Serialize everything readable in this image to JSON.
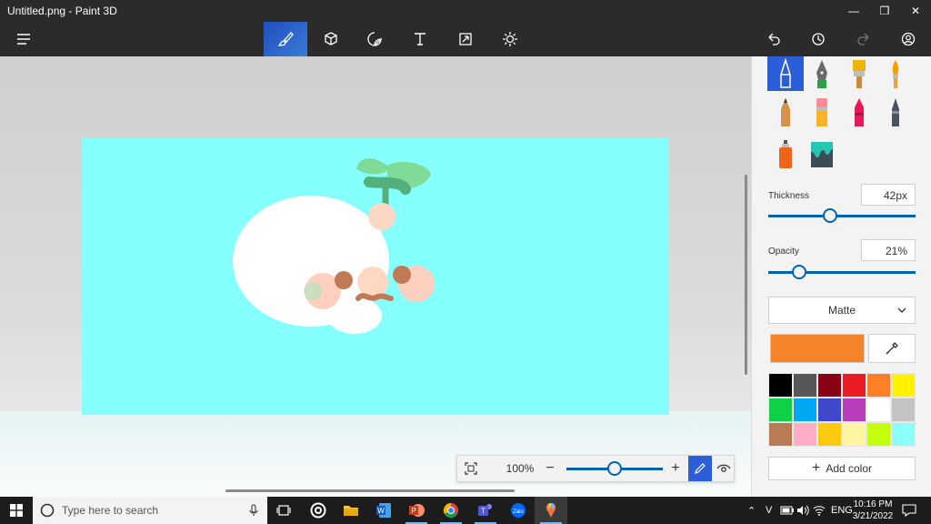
{
  "window": {
    "title": "Untitled.png - Paint 3D"
  },
  "toolbar": {
    "tools": [
      "brushes",
      "3d-shapes",
      "stickers",
      "text",
      "effects",
      "canvas",
      "magic-select"
    ],
    "icons": {
      "menu": "hamburger-icon",
      "undo": "undo-icon",
      "history": "history-icon",
      "redo": "redo-icon",
      "profile": "profile-icon"
    }
  },
  "zoom": {
    "value": "100%",
    "level": 0.5
  },
  "panel": {
    "thickness_label": "Thickness",
    "thickness_value": "42px",
    "thickness_level": 0.42,
    "opacity_label": "Opacity",
    "opacity_value": "21%",
    "opacity_level": 0.21,
    "finish": "Matte",
    "current_color": "#f5832a",
    "add_color_label": "Add color",
    "palette": [
      "#000000",
      "#575757",
      "#870014",
      "#ec1c24",
      "#ff7f27",
      "#fff200",
      "#0ed145",
      "#00a8f3",
      "#3f48cc",
      "#b83dba",
      "#ffffff",
      "#c3c3c3",
      "#b97a56",
      "#ffaec8",
      "#ffc90e",
      "#fff5a0",
      "#c4ff0e",
      "#8cfffb"
    ]
  },
  "taskbar": {
    "search_placeholder": "Type here to search",
    "lang": "ENG",
    "time": "10:16 PM",
    "date": "3/21/2022"
  },
  "colors": {
    "canvas": "#86ffff",
    "accent": "#2b5fd9"
  }
}
